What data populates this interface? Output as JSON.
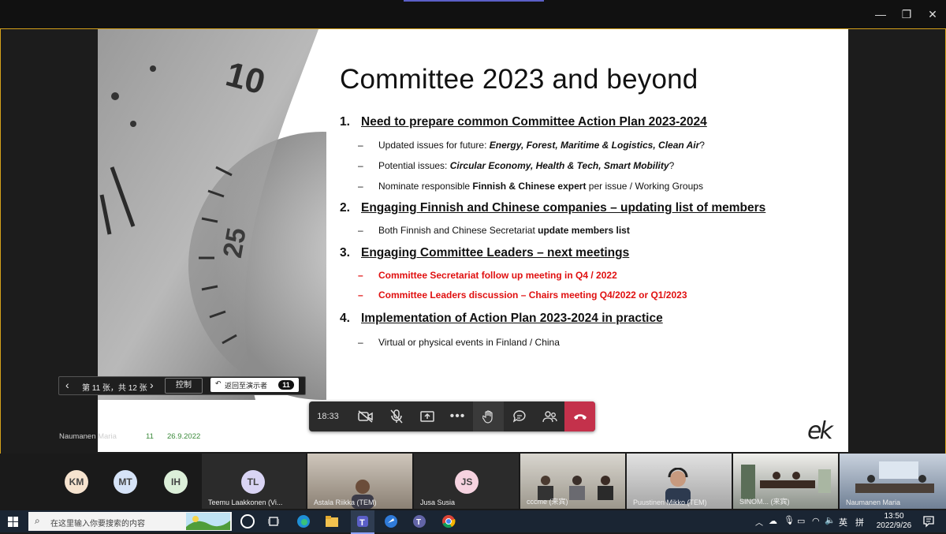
{
  "window": {
    "minimize": "—",
    "restore": "❐",
    "close": "✕"
  },
  "slide": {
    "title": "Committee 2023 and beyond",
    "sections": [
      {
        "num": "1.",
        "heading": "Need to prepare common Committee Action Plan 2023-2024"
      },
      {
        "num": "2.",
        "heading": "Engaging Finnish and Chinese companies – updating list of members"
      },
      {
        "num": "3.",
        "heading": "Engaging Committee Leaders – next meetings"
      },
      {
        "num": "4.",
        "heading": "Implementation of Action Plan 2023-2024 in practice"
      }
    ],
    "bullets": {
      "b1a_pre": "Updated issues for future: ",
      "b1a_em": "Energy, Forest, Maritime & Logistics, Clean Air",
      "b1a_post": "?",
      "b1b_pre": "Potential issues: ",
      "b1b_em": "Circular Economy, Health & Tech, Smart Mobility",
      "b1b_post": "?",
      "b1c_pre": "Nominate responsible ",
      "b1c_em": "Finnish & Chinese expert",
      "b1c_post": " per issue / Working Groups",
      "b2a_pre": "Both Finnish and Chinese Secretariat ",
      "b2a_em": "update members list",
      "b3a": "Committee Secretariat follow up meeting in Q4 / 2022",
      "b3b": "Committee Leaders discussion – Chairs meeting Q4/2022 or Q1/2023",
      "b4a": "Virtual or physical events in Finland / China",
      "dash": "–"
    },
    "dial_number_top": "10",
    "dial_number": "25",
    "footer": {
      "presenter": "Naumanen Maria",
      "page": "11",
      "date": "26.9.2022"
    },
    "logo": "ek"
  },
  "slide_nav": {
    "prev": "‹",
    "next": "›",
    "position": "第 11 张，共 12 张",
    "control": "控制",
    "back_to_presenter": "返回至演示者",
    "badge": "11"
  },
  "callbar": {
    "timer": "18:33"
  },
  "participants": [
    {
      "initials": "KM",
      "color": "#f6e3cf"
    },
    {
      "initials": "MT",
      "color": "#d6e3f7"
    },
    {
      "initials": "IH",
      "color": "#dcefd9"
    },
    {
      "initials": "TL",
      "color": "#d9d4f4",
      "name": "Teemu Laakkonen (Vi..."
    },
    {
      "name": "Astala Riikka (TEM)"
    },
    {
      "initials": "JS",
      "color": "#f6d3e0",
      "name": "Jusa Susia"
    },
    {
      "name": "cccme (来宾)"
    },
    {
      "name": "Puustinen Mikko (TEM)"
    },
    {
      "name": "SINOM... (来宾)"
    },
    {
      "name": "Naumanen Maria"
    }
  ],
  "taskbar": {
    "search_placeholder": "在这里输入你要搜索的内容",
    "lang": "英",
    "ime": "拼",
    "time": "13:50",
    "date": "2022/9/26"
  },
  "colors": {
    "accent": "#d6a21b",
    "hangup": "#c4314b",
    "red_text": "#e01010",
    "teams": "#5b5fc7"
  }
}
